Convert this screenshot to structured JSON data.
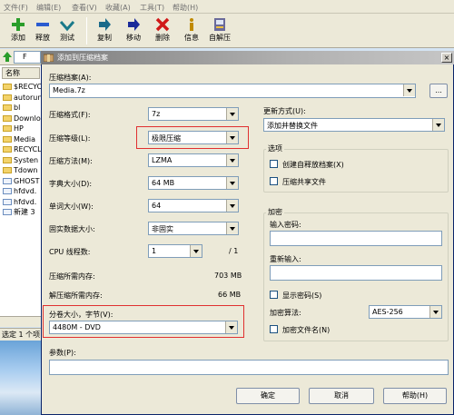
{
  "menu": [
    "文件(F)",
    "编辑(E)",
    "查看(V)",
    "收藏(A)",
    "工具(T)",
    "帮助(H)"
  ],
  "toolbar": [
    {
      "label": "添加",
      "icon": "add-icon"
    },
    {
      "label": "释放",
      "icon": "extract-icon"
    },
    {
      "label": "测试",
      "icon": "test-icon"
    },
    {
      "label": "复制",
      "icon": "copy-icon"
    },
    {
      "label": "移动",
      "icon": "move-icon"
    },
    {
      "label": "删除",
      "icon": "delete-icon"
    },
    {
      "label": "信息",
      "icon": "info-icon"
    },
    {
      "label": "自解压",
      "icon": "sfx-icon"
    }
  ],
  "address": "F",
  "file_list": {
    "header": "名称",
    "items": [
      {
        "name": "$RECYC",
        "kind": "folder"
      },
      {
        "name": "autorun",
        "kind": "folder"
      },
      {
        "name": "bl",
        "kind": "folder"
      },
      {
        "name": "Downlo",
        "kind": "folder"
      },
      {
        "name": "HP",
        "kind": "folder"
      },
      {
        "name": "Media",
        "kind": "folder"
      },
      {
        "name": "RECYCL",
        "kind": "folder"
      },
      {
        "name": "Systen",
        "kind": "folder"
      },
      {
        "name": "Tdown",
        "kind": "folder"
      },
      {
        "name": "GHOST",
        "kind": "file"
      },
      {
        "name": "hfdvd.",
        "kind": "file"
      },
      {
        "name": "hfdvd.",
        "kind": "file"
      },
      {
        "name": "新建 3",
        "kind": "file"
      }
    ]
  },
  "status": "选定 1 个项",
  "dialog": {
    "title": "添加到压缩档案",
    "close": "×",
    "archive_label": "压缩档案(A):",
    "archive_value": "Media.7z",
    "browse": "...",
    "format_label": "压缩格式(F):",
    "format_value": "7z",
    "level_label": "压缩等级(L):",
    "level_value": "极限压缩",
    "method_label": "压缩方法(M):",
    "method_value": "LZMA",
    "dict_label": "字典大小(D):",
    "dict_value": "64 MB",
    "word_label": "单词大小(W):",
    "word_value": "64",
    "solid_label": "固实数据大小:",
    "solid_value": "非固实",
    "cpu_label": "CPU 线程数:",
    "cpu_value": "1",
    "cpu_total": "/ 1",
    "mem_comp_label": "压缩所需内存:",
    "mem_comp_value": "703 MB",
    "mem_decomp_label": "解压缩所需内存:",
    "mem_decomp_value": "66 MB",
    "volume_label": "分卷大小，字节(V):",
    "volume_value": "4480M - DVD",
    "params_label": "参数(P):",
    "params_value": "",
    "update_label": "更新方式(U):",
    "update_value": "添加并替换文件",
    "options_title": "选项",
    "opt_sfx": "创建自释放档案(X)",
    "opt_shared": "压缩共享文件",
    "encrypt_title": "加密",
    "pwd_label": "输入密码:",
    "pwd_value": "",
    "repwd_label": "重新输入:",
    "repwd_value": "",
    "show_pwd": "显示密码(S)",
    "enc_method_label": "加密算法:",
    "enc_method_value": "AES-256",
    "enc_names": "加密文件名(N)",
    "ok": "确定",
    "cancel": "取消",
    "help": "帮助(H)"
  },
  "colors": {
    "highlight": "#e03030",
    "title_bar": "#7d7d7d"
  }
}
